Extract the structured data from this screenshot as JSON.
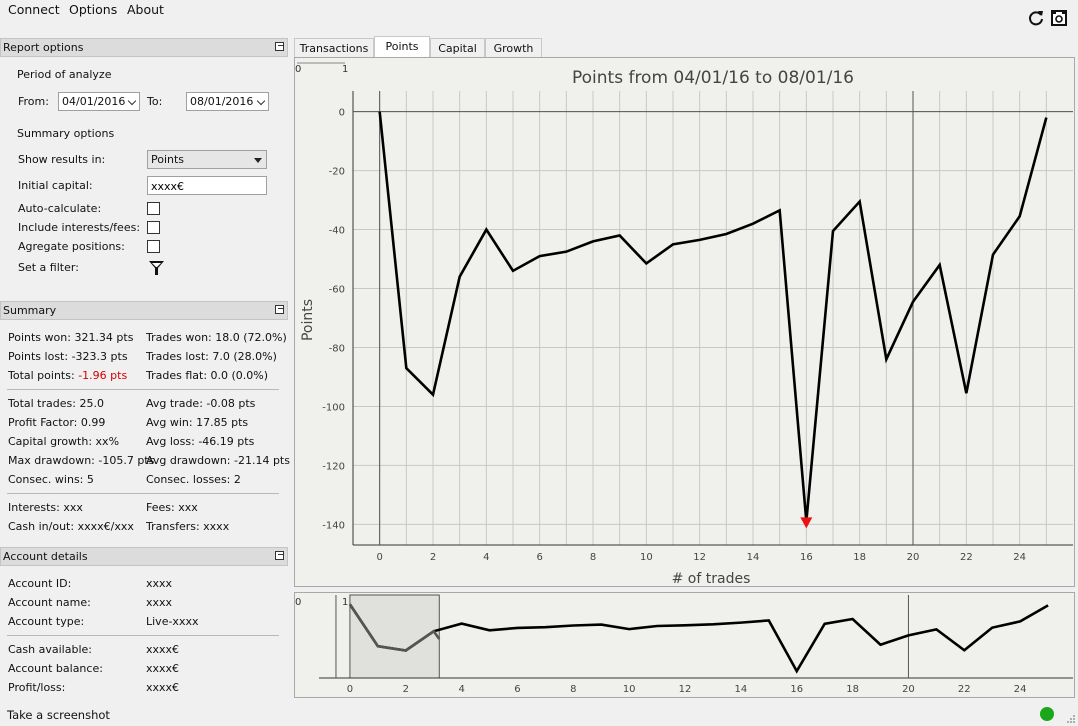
{
  "menu": [
    "Connect",
    "Options",
    "About"
  ],
  "toolbar": {
    "refresh_icon": "refresh-icon",
    "camera_icon": "camera-icon"
  },
  "report_options": {
    "title": "Report options",
    "period_label": "Period of analyze",
    "from_label": "From:",
    "from_value": "04/01/2016",
    "to_label": "To:",
    "to_value": "08/01/2016",
    "summary_label": "Summary options",
    "show_results_label": "Show results in:",
    "show_results_value": "Points",
    "initial_capital_label": "Initial capital:",
    "initial_capital_value": "xxxx€",
    "auto_calc_label": "Auto-calculate:",
    "interests_label": "Include interests/fees:",
    "agregate_label": "Agregate positions:",
    "filter_label": "Set a filter:"
  },
  "summary": {
    "title": "Summary",
    "points_won": "Points won: 321.34 pts",
    "points_lost": "Points lost: -323.3 pts",
    "total_points_label": "Total points: ",
    "total_points_value": "-1.96 pts",
    "trades_won": "Trades won: 18.0 (72.0%)",
    "trades_lost": "Trades lost: 7.0 (28.0%)",
    "trades_flat": "Trades flat: 0.0 (0.0%)",
    "total_trades": "Total trades: 25.0",
    "profit_factor": "Profit Factor: 0.99",
    "capital_growth": "Capital growth: xx%",
    "max_drawdown": "Max drawdown: -105.7 pts",
    "consec_wins": "Consec. wins: 5",
    "avg_trade": "Avg trade: -0.08 pts",
    "avg_win": "Avg win: 17.85 pts",
    "avg_loss": "Avg loss: -46.19 pts",
    "avg_drawdown": "Avg drawdown: -21.14 pts",
    "consec_losses": "Consec. losses: 2",
    "interests": "Interests: xxx",
    "cash_inout": "Cash in/out: xxxx€/xxx",
    "fees": "Fees: xxx",
    "transfers": "Transfers: xxxx"
  },
  "account": {
    "title": "Account details",
    "id_label": "Account ID:",
    "id_value": "xxxx",
    "name_label": "Account name:",
    "name_value": "xxxx",
    "type_label": "Account type:",
    "type_value": "Live-xxxx",
    "cash_label": "Cash available:",
    "cash_value": "xxxx€",
    "balance_label": "Account balance:",
    "balance_value": "xxxx€",
    "pl_label": "Profit/loss:",
    "pl_value": "xxxx€"
  },
  "tabs": [
    {
      "label": "Transactions",
      "active": false
    },
    {
      "label": "Points",
      "active": true
    },
    {
      "label": "Capital",
      "active": false
    },
    {
      "label": "Growth",
      "active": false
    }
  ],
  "status": {
    "text": "Take a screenshot",
    "color": "#1aa81a"
  },
  "colors": {
    "line": "#000000",
    "marker": "#ee1111",
    "grid": "#c8c8c8",
    "plot_bg": "#f0f0ec",
    "highlight": "#e0e0dc"
  },
  "chart_data": {
    "type": "line",
    "title": "Points from 04/01/16 to 08/01/16",
    "xlabel": "# of trades",
    "ylabel": "Points",
    "xlim": [
      -1,
      26
    ],
    "ylim": [
      -147,
      7
    ],
    "xticks": [
      0,
      2,
      4,
      6,
      8,
      10,
      12,
      14,
      16,
      18,
      20,
      22,
      24
    ],
    "yticks": [
      0,
      -20,
      -40,
      -60,
      -80,
      -100,
      -120,
      -140
    ],
    "corner_labels": [
      "0",
      "1"
    ],
    "grid": true,
    "x": [
      0,
      1,
      2,
      3,
      4,
      5,
      6,
      7,
      8,
      9,
      10,
      11,
      12,
      13,
      14,
      15,
      16,
      17,
      18,
      19,
      20,
      21,
      22,
      23,
      24,
      25
    ],
    "y": [
      0,
      -87,
      -96,
      -56,
      -40,
      -54,
      -49,
      -47.5,
      -44,
      -42,
      -51.5,
      -45,
      -43.5,
      -41.5,
      -38,
      -33.5,
      -139,
      -40.5,
      -30.5,
      -84,
      -64.5,
      -52,
      -95.5,
      -48.5,
      -35.5,
      -2
    ],
    "min_marker": {
      "x": 16,
      "y": -139
    },
    "navigator": {
      "xticks": [
        0,
        2,
        4,
        6,
        8,
        10,
        12,
        14,
        16,
        18,
        20,
        22,
        24
      ],
      "selection": [
        0,
        3.2
      ],
      "corner_labels": [
        "0",
        "1"
      ]
    }
  }
}
